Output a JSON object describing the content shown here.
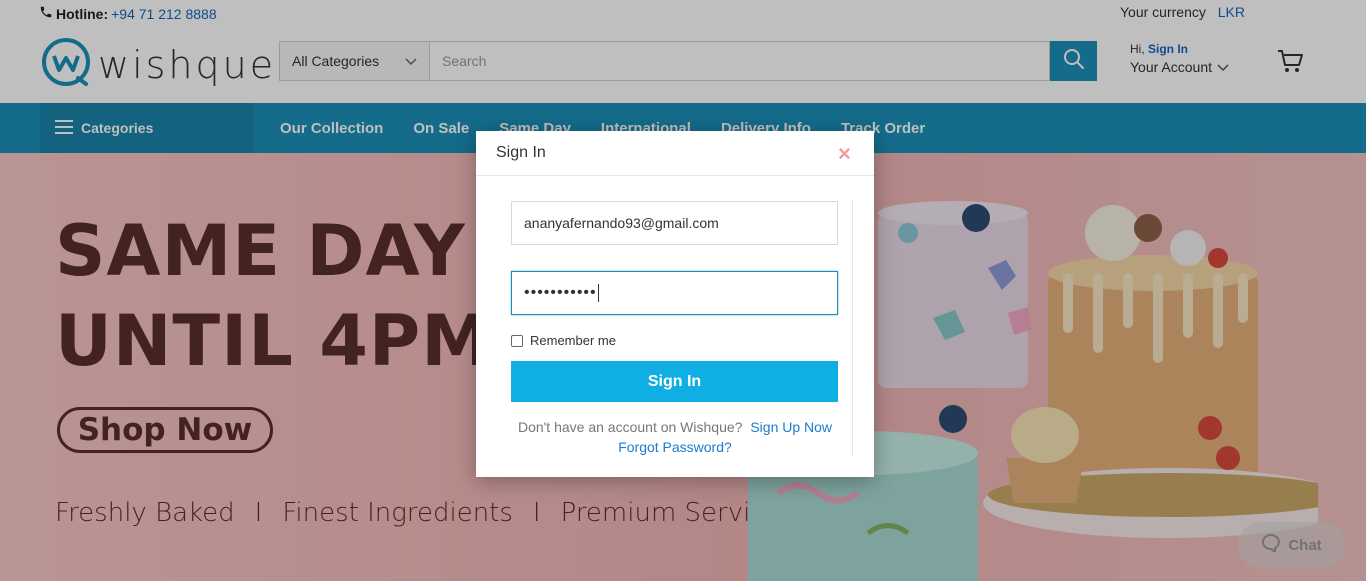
{
  "topbar": {
    "hotline_label": "Hotline:",
    "hotline_number": "+94 71 212 8888",
    "currency_label": "Your currency",
    "currency_value": "LKR"
  },
  "header": {
    "logo_text": "wishque",
    "category_select": "All Categories",
    "search_placeholder": "Search",
    "account_hi": "Hi,",
    "account_signin": "Sign In",
    "account_label": "Your Account"
  },
  "nav": {
    "categories_label": "Categories",
    "links": [
      "Our Collection",
      "On Sale",
      "Same Day",
      "International",
      "Delivery Info",
      "Track Order"
    ]
  },
  "hero": {
    "title_line1": "SAME DAY D",
    "title_line2": "UNTIL 4PM",
    "button": "Shop Now",
    "tag1": "Freshly Baked",
    "sep": "I",
    "tag2": "Finest Ingredients",
    "tag3": "Premium Service",
    "chat_label": "Chat"
  },
  "modal": {
    "title": "Sign In",
    "close": "×",
    "email_value": "ananyafernando93@gmail.com",
    "password_value": "•••••••••••",
    "remember_label": "Remember me",
    "signin_button": "Sign In",
    "signup_prompt": "Don't have an account on Wishque?",
    "signup_link": "Sign Up Now",
    "forgot_link": "Forgot Password?"
  },
  "colors": {
    "brand_blue": "#1b8fb8",
    "signin_button": "#0faee3",
    "link": "#1a7bd0",
    "hero_text": "#5a2f2c"
  }
}
